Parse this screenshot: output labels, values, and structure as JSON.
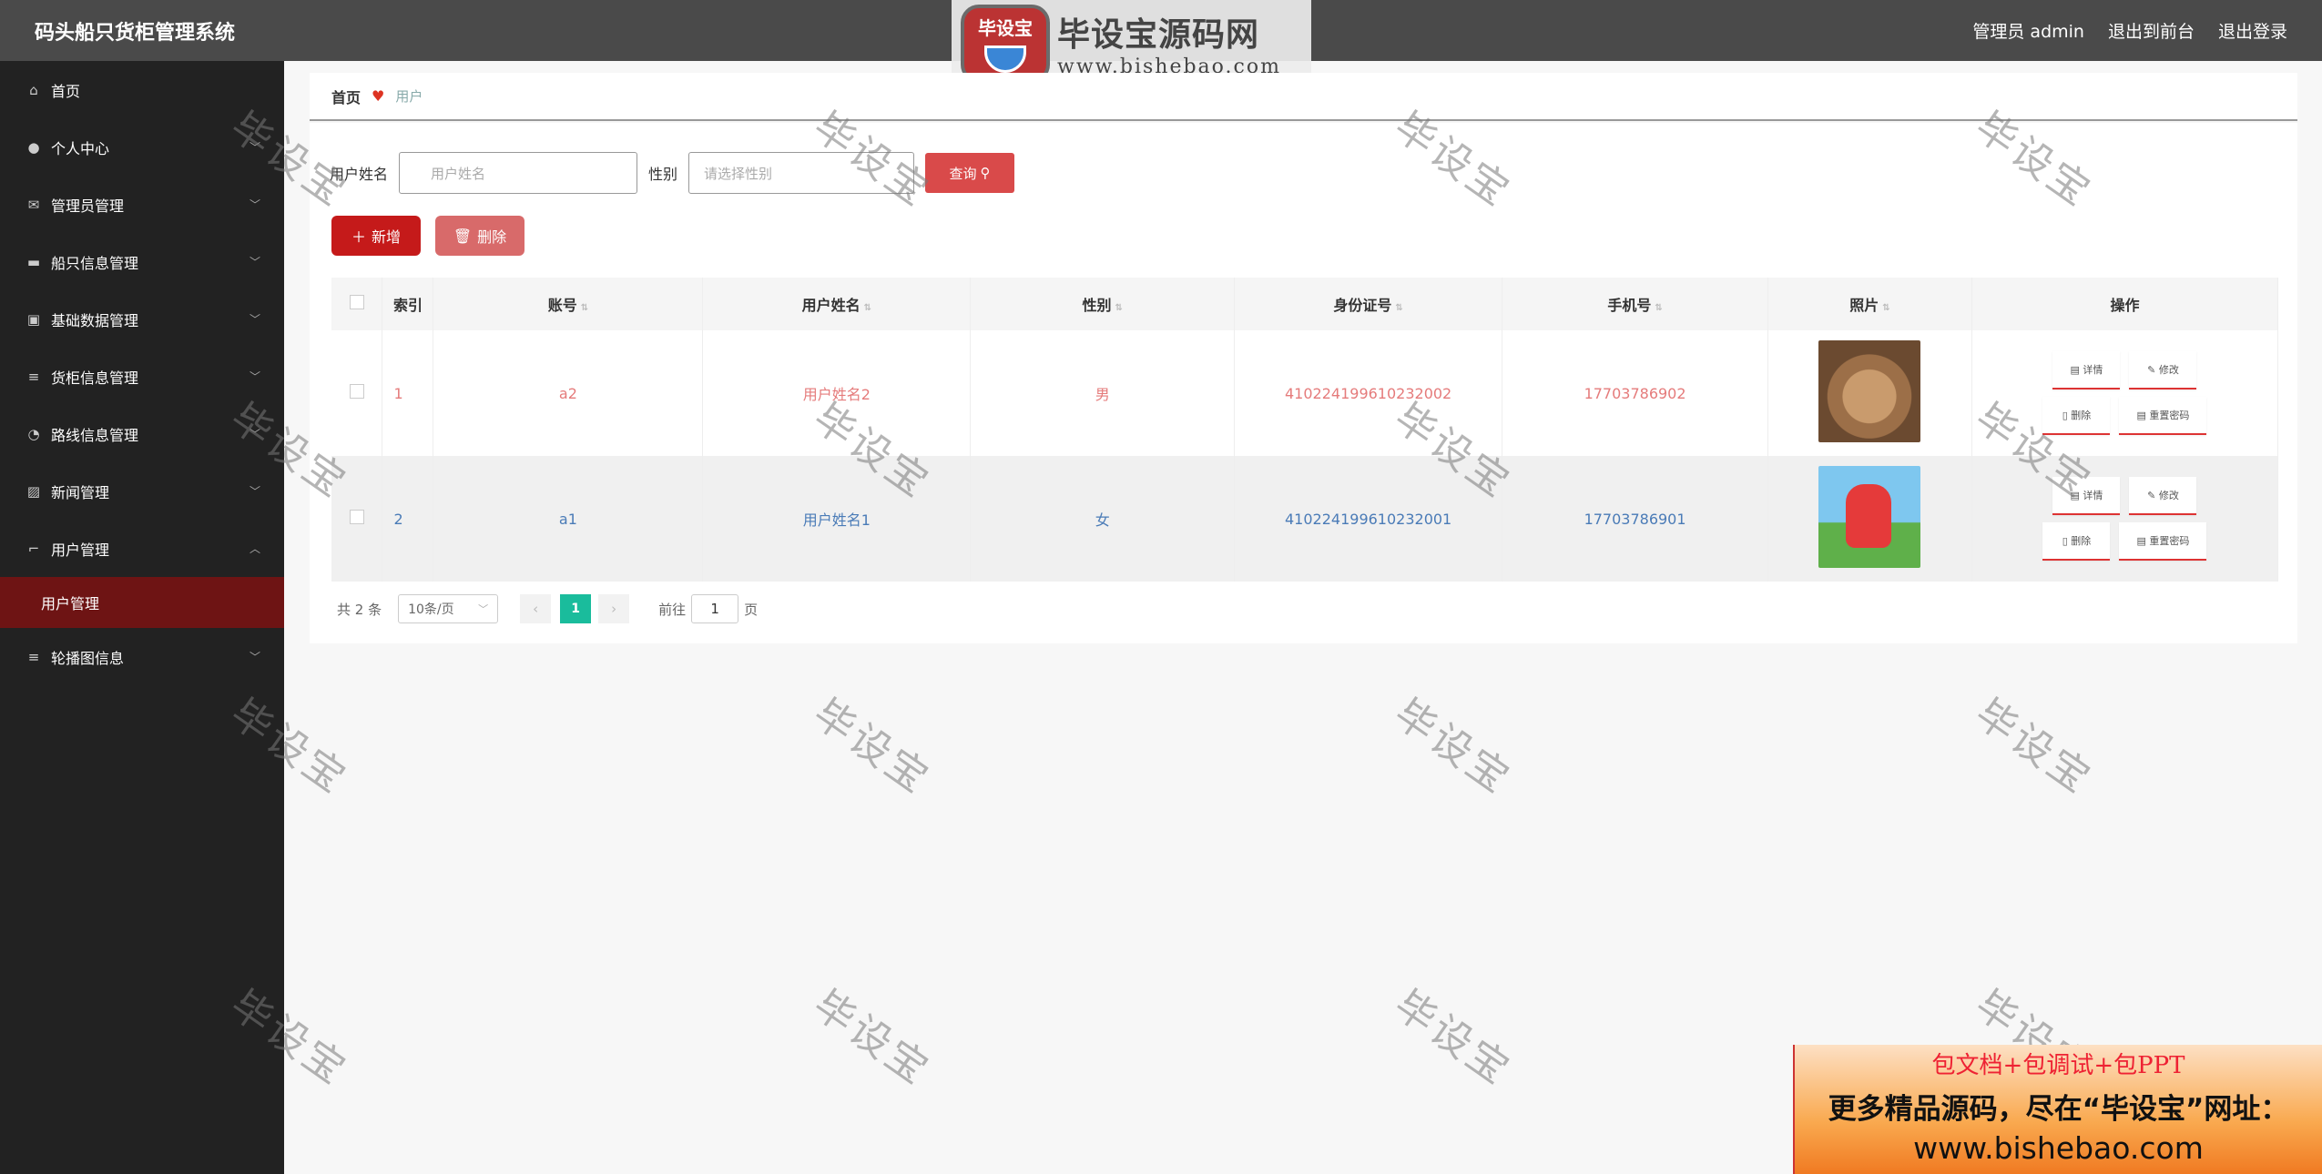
{
  "app": {
    "title": "码头船只货柜管理系统",
    "top_actions": [
      "管理员 admin",
      "退出到前台",
      "退出登录"
    ]
  },
  "logo": {
    "badge_text": "毕设宝",
    "title": "毕设宝源码网",
    "url": "www.bishebao.com"
  },
  "sidebar": {
    "items": [
      {
        "label": "首页",
        "icon": "home-icon"
      },
      {
        "label": "个人中心",
        "icon": "user-icon"
      },
      {
        "label": "管理员管理",
        "icon": "mail-icon"
      },
      {
        "label": "船只信息管理",
        "icon": "ship-icon"
      },
      {
        "label": "基础数据管理",
        "icon": "clipboard-icon"
      },
      {
        "label": "货柜信息管理",
        "icon": "list-icon"
      },
      {
        "label": "路线信息管理",
        "icon": "gauge-icon"
      },
      {
        "label": "新闻管理",
        "icon": "chart-icon"
      },
      {
        "label": "用户管理",
        "icon": "crop-icon"
      },
      {
        "label": "轮播图信息",
        "icon": "list-icon"
      }
    ],
    "active_sub": "用户管理"
  },
  "breadcrumb": {
    "home": "首页",
    "current": "用户"
  },
  "search": {
    "name_label": "用户姓名",
    "name_placeholder": "用户姓名",
    "gender_label": "性别",
    "gender_placeholder": "请选择性别",
    "query_label": "查询"
  },
  "toolbar": {
    "add_label": "新增",
    "delete_label": "删除"
  },
  "table": {
    "headers": [
      "索引",
      "账号",
      "用户姓名",
      "性别",
      "身份证号",
      "手机号",
      "照片",
      "操作"
    ],
    "rows": [
      {
        "index": "1",
        "account": "a2",
        "name": "用户姓名2",
        "gender": "男",
        "id_no": "410224199610232002",
        "phone": "17703786902",
        "photo": "cat-photo"
      },
      {
        "index": "2",
        "account": "a1",
        "name": "用户姓名1",
        "gender": "女",
        "id_no": "410224199610232001",
        "phone": "17703786901",
        "photo": "cartoon-photo"
      }
    ],
    "ops": {
      "detail": "详情",
      "edit": "修改",
      "delete": "删除",
      "reset": "重置密码"
    }
  },
  "pager": {
    "total": "共 2 条",
    "size": "10条/页",
    "current": "1",
    "goto_prefix": "前往",
    "goto_value": "1",
    "goto_suffix": "页"
  },
  "watermark": "毕设宝",
  "ad": {
    "line1": "包文档+包调试+包PPT",
    "line2": "更多精品源码，尽在“毕设宝”网址：",
    "line3": "www.bishebao.com"
  },
  "colors": {
    "sidebar_bg": "#222222",
    "header_bg": "#4a4a4a",
    "accent": "#c51a1a",
    "active_sub_bg": "#6e1414",
    "page_active": "#1abc9c"
  }
}
